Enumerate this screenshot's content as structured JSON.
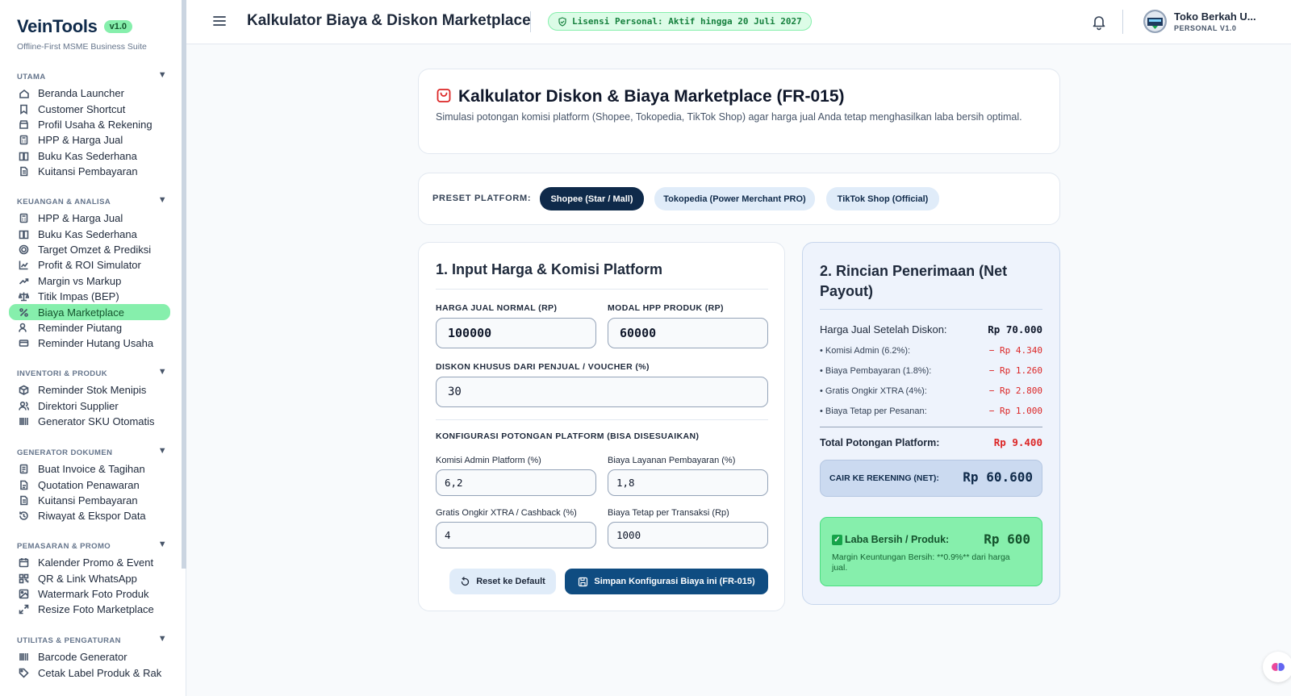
{
  "app": {
    "name": "VeinTools",
    "version": "v1.0",
    "tagline": "Offline-First MSME Business Suite"
  },
  "sidebar": {
    "sections": [
      {
        "title": "UTAMA",
        "items": [
          {
            "label": "Beranda Launcher",
            "icon": "home-icon"
          },
          {
            "label": "Customer Shortcut",
            "icon": "bookmark-icon"
          },
          {
            "label": "Profil Usaha & Rekening",
            "icon": "store-icon"
          },
          {
            "label": "HPP & Harga Jual",
            "icon": "calculator-icon"
          },
          {
            "label": "Buku Kas Sederhana",
            "icon": "book-icon"
          },
          {
            "label": "Kuitansi Pembayaran",
            "icon": "receipt-icon"
          }
        ]
      },
      {
        "title": "KEUANGAN & ANALISA",
        "items": [
          {
            "label": "HPP & Harga Jual",
            "icon": "calculator-icon"
          },
          {
            "label": "Buku Kas Sederhana",
            "icon": "book-icon"
          },
          {
            "label": "Target Omzet & Prediksi",
            "icon": "target-icon"
          },
          {
            "label": "Profit & ROI Simulator",
            "icon": "chart-line-icon"
          },
          {
            "label": "Margin vs Markup",
            "icon": "trending-up-icon"
          },
          {
            "label": "Titik Impas (BEP)",
            "icon": "scale-icon"
          },
          {
            "label": "Biaya Marketplace",
            "icon": "percent-icon",
            "active": true
          },
          {
            "label": "Reminder Piutang",
            "icon": "user-clock-icon"
          },
          {
            "label": "Reminder Hutang Usaha",
            "icon": "credit-card-icon"
          }
        ]
      },
      {
        "title": "INVENTORI & PRODUK",
        "items": [
          {
            "label": "Reminder Stok Menipis",
            "icon": "package-icon"
          },
          {
            "label": "Direktori Supplier",
            "icon": "users-icon"
          },
          {
            "label": "Generator SKU Otomatis",
            "icon": "barcode-icon"
          }
        ]
      },
      {
        "title": "GENERATOR DOKUMEN",
        "items": [
          {
            "label": "Buat Invoice & Tagihan",
            "icon": "invoice-icon"
          },
          {
            "label": "Quotation Penawaran",
            "icon": "file-text-icon"
          },
          {
            "label": "Kuitansi Pembayaran",
            "icon": "receipt-icon"
          },
          {
            "label": "Riwayat & Ekspor Data",
            "icon": "history-icon"
          }
        ]
      },
      {
        "title": "PEMASARAN & PROMO",
        "items": [
          {
            "label": "Kalender Promo & Event",
            "icon": "calendar-icon"
          },
          {
            "label": "QR & Link WhatsApp",
            "icon": "qr-icon"
          },
          {
            "label": "Watermark Foto Produk",
            "icon": "image-icon"
          },
          {
            "label": "Resize Foto Marketplace",
            "icon": "resize-icon"
          }
        ]
      },
      {
        "title": "UTILITAS & PENGATURAN",
        "items": [
          {
            "label": "Barcode Generator",
            "icon": "barcode-icon"
          },
          {
            "label": "Cetak Label Produk & Rak",
            "icon": "tag-icon"
          }
        ]
      }
    ]
  },
  "header": {
    "title": "Kalkulator Biaya & Diskon Marketplace",
    "license": "Lisensi Personal: Aktif hingga 20 Juli 2027",
    "user_name": "Toko Berkah U...",
    "user_role": "PERSONAL V1.0"
  },
  "page": {
    "title": "Kalkulator Diskon & Biaya Marketplace (FR-015)",
    "description": "Simulasi potongan komisi platform (Shopee, Tokopedia, TikTok Shop) agar harga jual Anda tetap menghasilkan laba bersih optimal."
  },
  "preset": {
    "label": "PRESET PLATFORM:",
    "options": [
      "Shopee (Star / Mall)",
      "Tokopedia (Power Merchant PRO)",
      "TikTok Shop (Official)"
    ],
    "selected": "Shopee (Star / Mall)"
  },
  "input_panel": {
    "title": "1. Input Harga & Komisi Platform",
    "harga_jual_label": "HARGA JUAL NORMAL (RP)",
    "harga_jual_value": "100000",
    "modal_hpp_label": "MODAL HPP PRODUK (RP)",
    "modal_hpp_value": "60000",
    "diskon_label": "DISKON KHUSUS DARI PENJUAL / VOUCHER (%)",
    "diskon_value": "30",
    "config_title": "KONFIGURASI POTONGAN PLATFORM (BISA DISESUAIKAN)",
    "komisi_label": "Komisi Admin Platform (%)",
    "komisi_value": "6,2",
    "layanan_label": "Biaya Layanan Pembayaran (%)",
    "layanan_value": "1,8",
    "ongkir_label": "Gratis Ongkir XTRA / Cashback (%)",
    "ongkir_value": "4",
    "tetap_label": "Biaya Tetap per Transaksi (Rp)",
    "tetap_value": "1000",
    "reset_label": "Reset ke Default",
    "save_label": "Simpan Konfigurasi Biaya ini (FR-015)"
  },
  "result_panel": {
    "title": "2. Rincian Penerimaan (Net Payout)",
    "harga_setelah_diskon_label": "Harga Jual Setelah Diskon:",
    "harga_setelah_diskon_value": "Rp 70.000",
    "deductions": [
      {
        "label": "• Komisi Admin (6.2%):",
        "value": "− Rp 4.340"
      },
      {
        "label": "• Biaya Pembayaran (1.8%):",
        "value": "− Rp 1.260"
      },
      {
        "label": "• Gratis Ongkir XTRA (4%):",
        "value": "− Rp 2.800"
      },
      {
        "label": "• Biaya Tetap per Pesanan:",
        "value": "− Rp 1.000"
      }
    ],
    "total_label": "Total Potongan Platform:",
    "total_value": "Rp 9.400",
    "net_label": "CAIR KE REKENING (NET):",
    "net_value": "Rp 60.600",
    "profit_label": "Laba Bersih / Produk:",
    "profit_value": "Rp 600",
    "profit_note": "Margin Keuntungan Bersih: **0.9%** dari harga jual."
  },
  "colors": {
    "brand": "#0f2a4a",
    "accent_green": "#86efac",
    "danger": "#dc2626"
  }
}
